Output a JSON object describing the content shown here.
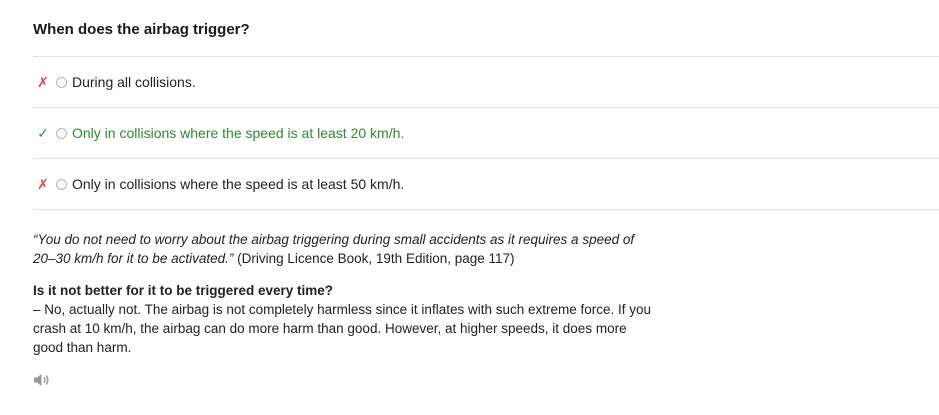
{
  "question": "When does the airbag trigger?",
  "options": [
    {
      "mark": "✗",
      "status": "wrong",
      "text": "During all collisions."
    },
    {
      "mark": "✓",
      "status": "correct",
      "text": "Only in collisions where the speed is at least 20 km/h."
    },
    {
      "mark": "✗",
      "status": "wrong",
      "text": "Only in collisions where the speed is at least 50 km/h."
    }
  ],
  "explanation": {
    "quote": "“You do not need to worry about the airbag triggering during small accidents as it requires a speed of 20–30 km/h for it to be activated.”",
    "source": " (Driving Licence Book, 19th Edition, page 117)",
    "sub_question": "Is it not better for it to be triggered every time?",
    "answer": "– No, actually not. The airbag is not completely harmless since it inflates with such extreme force. If you crash at 10 km/h, the airbag can do more harm than good. However, at higher speeds, it does more good than harm."
  },
  "audio": {
    "icon": "speaker-icon"
  },
  "colors": {
    "wrong_mark": "#e04848",
    "correct_mark": "#3e9a3e",
    "correct_text": "#2f8a2f",
    "divider": "#e2e2e2"
  }
}
